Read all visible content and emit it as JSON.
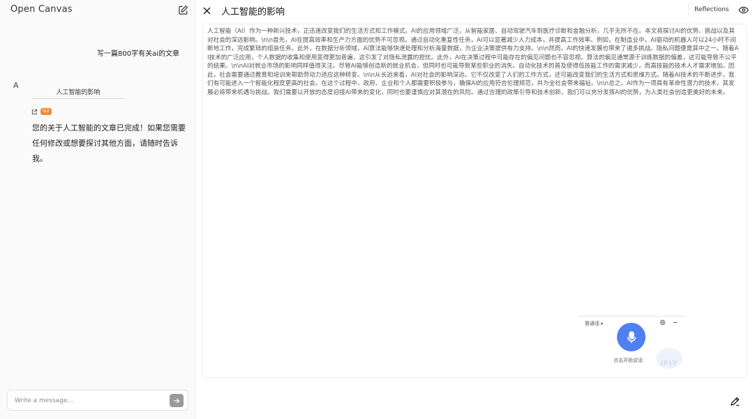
{
  "sidebar": {
    "app_title": "Open Canvas",
    "user_message": "写一篇800字有关ai的文章",
    "assistant_avatar": "A",
    "artifact_title": "人工智能的影响",
    "tool_badge": "%2",
    "assistant_reply": "您的关于人工智能的文章已完成！如果您需要任何修改或想要探讨其他方面，请随时告诉我。",
    "composer": {
      "placeholder": "Write a message..."
    }
  },
  "canvas": {
    "doc_title": "人工智能的影响",
    "reflections_label": "Reflections",
    "body": "人工智能（AI）作为一种新兴技术，正迅速改变我们的生活方式和工作模式。AI的应用领域广泛，从智能家居、自动驾驶汽车到医疗诊断和金融分析，几乎无所不在。本文将探讨AI的优势、挑战以及其对社会的深远影响。\\n\\n首先，AI在提高效率和生产力方面的优势不可忽视。通过自动化重复性任务，AI可以显著减少人力成本，并提高工作效率。例如，在制造业中，AI驱动的机器人可以24小时不间断地工作，完成繁琐的组装任务。此外，在数据分析领域，AI算法能够快速处理和分析海量数据，为企业决策提供有力支持。\\n\\n然而，AI的快速发展也带来了诸多挑战。隐私问题便是其中之一。随着AI技术的广泛应用，个人数据的收集和使用变得更加普遍，这引发了对隐私泄露的担忧。此外，AI在决策过程中可能存在的偏见问题也不容忽视。算法的偏见通常源于训练数据的偏差，这可能导致不公平的结果。\\n\\nAI对就业市场的影响同样值得关注。尽管AI能够创造新的就业机会，但同时也可能导致某些职业的消失。自动化技术的普及使得低技能工作的需求减少，而高技能的技术人才需求增加。因此，社会需要通过教育和培训来帮助劳动力适应这种转变。\\n\\n从长远来看，AI对社会的影响深远。它不仅改变了人们的工作方式，还可能改变我们的生活方式和思维方式。随着AI技术的不断进步，我们有可能进入一个智能化程度更高的社会。在这个过程中，政府、企业和个人都需要积极参与，确保AI的应用符合伦理规范，并为全社会带来福祉。\\n\\n总之，AI作为一项具有革命性潜力的技术，其发展必将带来机遇与挑战。我们需要以开放的态度迎接AI带来的变化，同时也要谨慎应对其潜在的风险。通过合理的政策引导和技术创新，我们可以充分发挥AI的优势，为人类社会创造更美好的未来。"
  },
  "voice_input": {
    "language": "普通话",
    "hint": "点击开始说话",
    "logo_text": "iFLY",
    "accent_color": "#4f7ff0"
  }
}
